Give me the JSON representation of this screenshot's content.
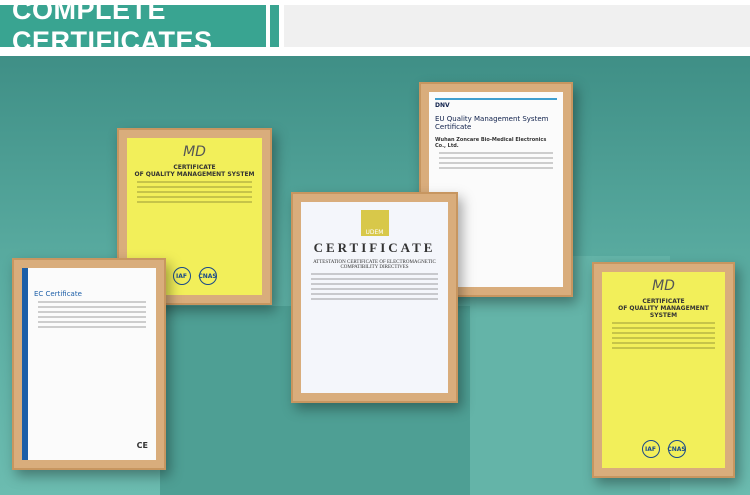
{
  "header": {
    "title": "COMPLETE CERTIFICATES"
  },
  "certificates": [
    {
      "id": "qms-left",
      "heading": "CERTIFICATE",
      "subheading": "OF QUALITY MANAGEMENT SYSTEM",
      "logos": [
        "IAF",
        "CNAS"
      ]
    },
    {
      "id": "ec",
      "heading": "EC Certificate",
      "logos": [
        "CE"
      ]
    },
    {
      "id": "udem",
      "brand": "UDEM",
      "heading": "CERTIFICATE",
      "subheading": "ATTESTATION CERTIFICATE OF ELECTROMAGNETIC COMPATIBILITY DIRECTIVES"
    },
    {
      "id": "dnv",
      "brand": "DNV",
      "heading": "EU Quality Management System Certificate",
      "company": "Wuhan Zoncare Bio-Medical Electronics Co., Ltd."
    },
    {
      "id": "qms-right",
      "heading": "CERTIFICATE",
      "subheading": "OF QUALITY MANAGEMENT SYSTEM",
      "logos": [
        "IAF",
        "CNAS"
      ]
    }
  ]
}
